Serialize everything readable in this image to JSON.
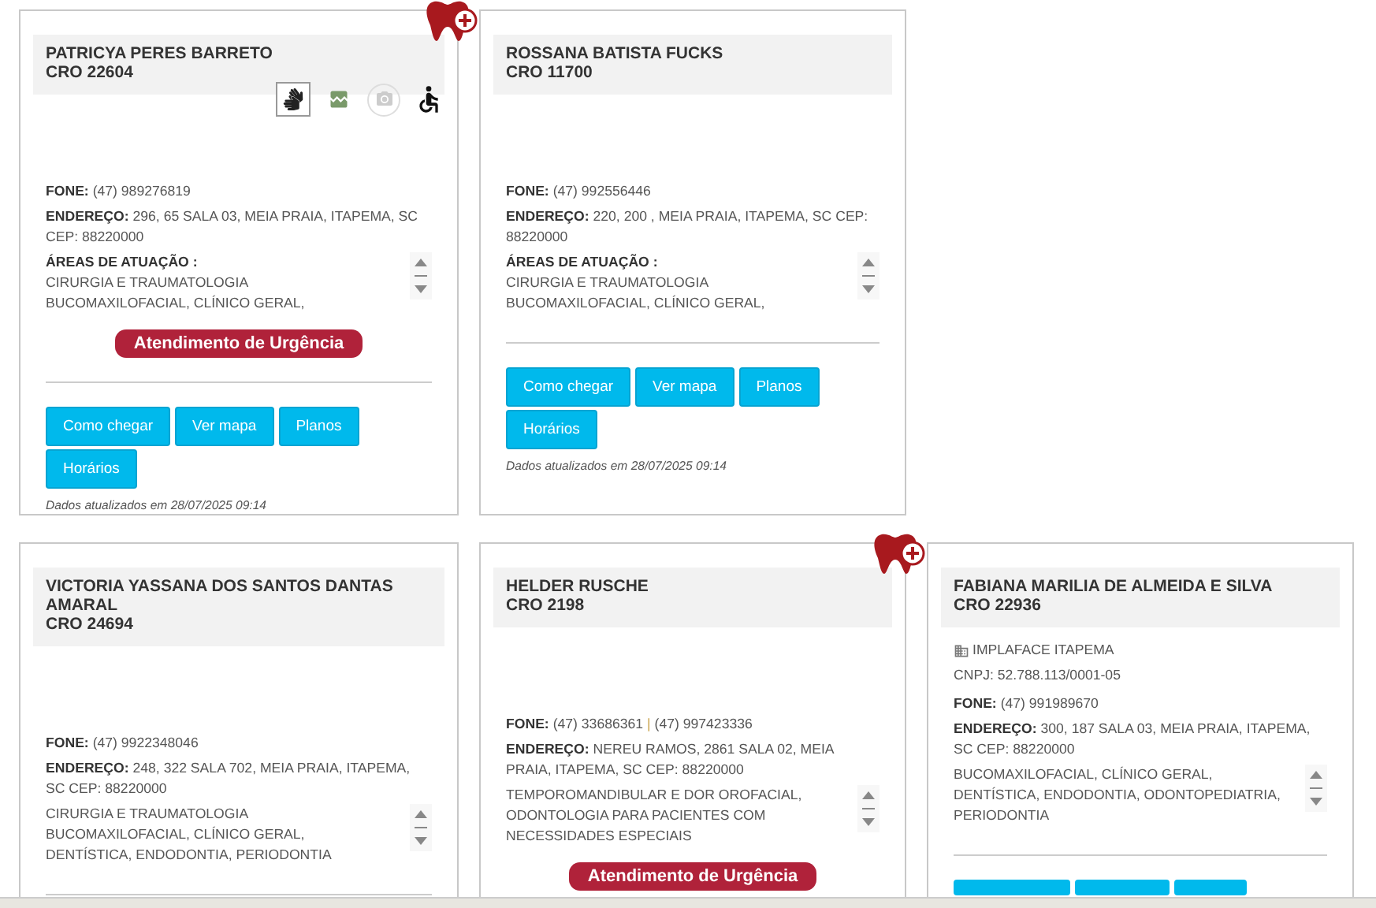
{
  "cards": [
    {
      "name": "PATRICYA PERES BARRETO",
      "cro": "CRO 22604",
      "featured": true,
      "icons": [
        {
          "kind": "sign_language"
        },
        {
          "kind": "image"
        },
        {
          "kind": "camera"
        },
        {
          "kind": "wheelchair"
        }
      ],
      "phone_label": "FONE:",
      "phones": [
        "(47) 989276819"
      ],
      "address_label": "ENDEREÇO:",
      "address": "296, 65 SALA 03, MEIA PRAIA, ITAPEMA, SC CEP: 88220000",
      "areas_label": "ÁREAS DE ATUAÇÃO :",
      "areas": "CIRURGIA E TRAUMATOLOGIA\nBUCOMAXILOFACIAL, CLÍNICO GERAL,",
      "urgent": "Atendimento de Urgência",
      "buttons": [
        "Como chegar",
        "Ver mapa",
        "Planos",
        "Horários"
      ],
      "updated": "Dados atualizados em 28/07/2025 09:14"
    },
    {
      "name": "ROSSANA BATISTA FUCKS",
      "cro": "CRO 11700",
      "featured": false,
      "phone_label": "FONE:",
      "phones": [
        "(47) 992556446"
      ],
      "address_label": "ENDEREÇO:",
      "address": "220, 200 , MEIA PRAIA, ITAPEMA, SC CEP: 88220000",
      "areas_label": "ÁREAS DE ATUAÇÃO :",
      "areas": "CIRURGIA E TRAUMATOLOGIA\nBUCOMAXILOFACIAL, CLÍNICO GERAL,",
      "buttons": [
        "Como chegar",
        "Ver mapa",
        "Planos",
        "Horários"
      ],
      "updated": "Dados atualizados em 28/07/2025 09:14"
    },
    {
      "name": "VICTORIA YASSANA DOS SANTOS DANTAS AMARAL",
      "cro": "CRO 24694",
      "featured": false,
      "phone_label": "FONE:",
      "phones": [
        "(47) 9922348046"
      ],
      "address_label": "ENDEREÇO:",
      "address": "248, 322 SALA 702, MEIA PRAIA, ITAPEMA, SC CEP: 88220000",
      "areas": "CIRURGIA E TRAUMATOLOGIA\nBUCOMAXILOFACIAL, CLÍNICO GERAL,\nDENTÍSTICA, ENDODONTIA, PERIODONTIA"
    },
    {
      "name": "HELDER RUSCHE",
      "cro": "CRO 2198",
      "featured": true,
      "phone_label": "FONE:",
      "phones": [
        "(47) 33686361",
        "(47) 997423336"
      ],
      "phone_separator": "|",
      "address_label": "ENDEREÇO:",
      "address": "NEREU RAMOS, 2861 SALA 02, MEIA PRAIA, ITAPEMA, SC CEP: 88220000",
      "areas": "TEMPOROMANDIBULAR E DOR OROFACIAL,\nODONTOLOGIA PARA PACIENTES COM\nNECESSIDADES ESPECIAIS",
      "urgent": "Atendimento de Urgência"
    },
    {
      "name": "FABIANA MARILIA DE ALMEIDA E SILVA",
      "cro": "CRO 22936",
      "featured": false,
      "company": "IMPLAFACE ITAPEMA",
      "cnpj": "CNPJ: 52.788.113/0001-05",
      "phone_label": "FONE:",
      "phones": [
        "(47) 991989670"
      ],
      "address_label": "ENDEREÇO:",
      "address": "300, 187 SALA 03, MEIA PRAIA, ITAPEMA, SC CEP: 88220000",
      "areas": "BUCOMAXILOFACIAL, CLÍNICO GERAL,\nDENTÍSTICA, ENDODONTIA, ODONTOPEDIATRIA,\nPERIODONTIA",
      "partial_buttons": true
    }
  ]
}
